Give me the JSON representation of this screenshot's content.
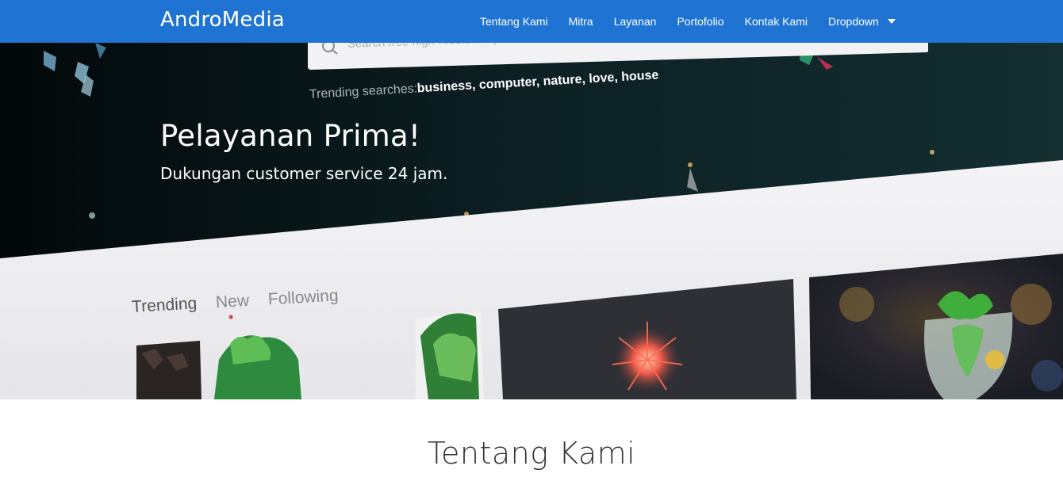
{
  "navbar": {
    "brand": "AndroMedia",
    "items": [
      "Tentang Kami",
      "Mitra",
      "Layanan",
      "Portofolio",
      "Kontak Kami",
      "Dropdown"
    ],
    "bg_color": "#1f74d3"
  },
  "hero": {
    "title": "Pelayanan Prima!",
    "subtitle": "Dukungan customer service 24 jam.",
    "background": {
      "search_placeholder": "Search free high-resolution photos",
      "trending_label": "Trending searches:",
      "trending_terms": "business, computer, nature, love, house",
      "tabs": [
        "Trending",
        "New",
        "Following"
      ]
    }
  },
  "section": {
    "title": "Tentang Kami"
  }
}
